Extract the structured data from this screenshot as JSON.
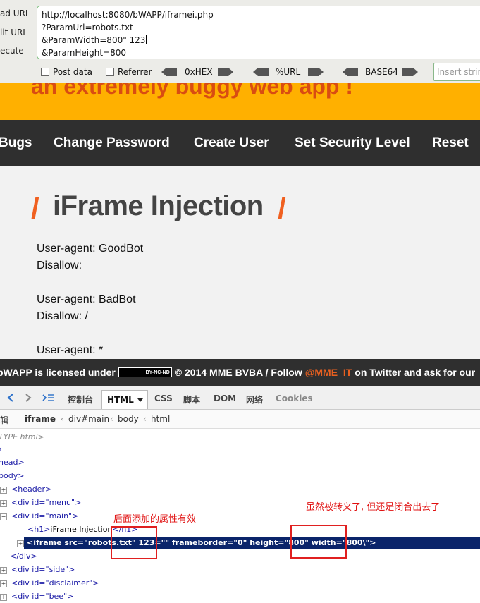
{
  "hackbar": {
    "side_labels": [
      "ad URL",
      "lit URL",
      "ecute"
    ],
    "url_lines": [
      "http://localhost:8080/bWAPP/iframei.php",
      "?ParamUrl=robots.txt",
      "&ParamWidth=800\" 123",
      "&ParamHeight=800"
    ],
    "post_data_label": "Post data",
    "referrer_label": "Referrer",
    "hex_label": "0xHEX",
    "url_enc_label": "%URL",
    "base64_label": "BASE64",
    "insert_placeholder": "Insert string"
  },
  "page": {
    "banner_text": "an extremely buggy web app !",
    "menu": [
      "Bugs",
      "Change Password",
      "Create User",
      "Set Security Level",
      "Reset"
    ],
    "title_slash_left": "/",
    "title": "iFrame Injection",
    "title_slash_right": "/",
    "robots_lines": [
      "User-agent: GoodBot",
      "Disallow:",
      "User-agent: BadBot",
      "Disallow: /",
      "User-agent: *"
    ],
    "footer": {
      "prefix": "bWAPP is licensed under",
      "cc_badge": "BY-NC-ND",
      "middle": "© 2014 MME BVBA / Follow",
      "twitter": "@MME_IT",
      "suffix": "on Twitter and ask for our"
    }
  },
  "devtools": {
    "tabs": [
      "控制台",
      "HTML",
      "CSS",
      "脚本",
      "DOM",
      "网络",
      "Cookies"
    ],
    "breadcrumb": [
      "iframe",
      "div#main",
      "body",
      "html"
    ],
    "breadcrumb_edit": "辑",
    "tree": {
      "doctype": "TYPE html>",
      "head": "head>",
      "body": "body>",
      "header": "<header>",
      "menu": "<div id=\"menu\">",
      "main": "<div id=\"main\">",
      "h1_open": "<h1>",
      "h1_text": "iFrame Injection",
      "h1_close": "</h1>",
      "iframe_src_attr": "src=\"robots.txt\"",
      "iframe_injected": "123=\"\"",
      "iframe_rest": "frameborder=\"0\" height=\"800\" width=\"800\\\">",
      "div_close": "</div>",
      "side": "<div id=\"side\">",
      "disclaimer": "<div id=\"disclaimer\">",
      "bee": "<div id=\"bee\">"
    },
    "annotations": {
      "left": "后面添加的属性有效",
      "right": "虽然被转义了, 但还是闭合出去了"
    }
  }
}
